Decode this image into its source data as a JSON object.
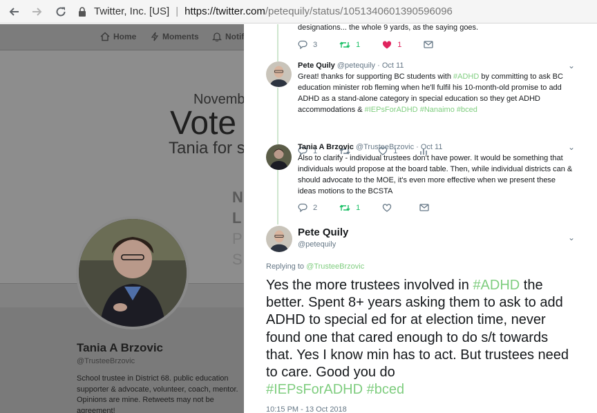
{
  "browser": {
    "back_icon": "arrow-left-icon",
    "forward_icon": "arrow-right-icon",
    "reload_icon": "reload-icon",
    "site_org": "Twitter, Inc. [US]",
    "url_scheme_host": "https://twitter.com",
    "url_path": "/petequily/status/1051340601390596096"
  },
  "profile_page": {
    "nav": {
      "home": "Home",
      "moments": "Moments",
      "notifications": "Notifi"
    },
    "banner": {
      "line1": "Novemb",
      "line2": "Vote",
      "line3": "Tania for s"
    },
    "name": "Tania A Brzovic",
    "handle": "@TrusteeBrzovic",
    "bio": "School trustee in District 68. public education supporter & advocate, volunteer, coach, mentor. Opinions are mine. Retweets may not be agreement!"
  },
  "thread": {
    "tweet0": {
      "text_tail": "designations... the whole 9 yards, as the saying goes.",
      "reply_count": "3",
      "retweet_count": "1",
      "like_count": "1"
    },
    "tweet1": {
      "name": "Pete Quily",
      "handle": "@petequily",
      "date": "· Oct 11",
      "text_a": "Great! thanks for supporting BC students with ",
      "tag_a": "#ADHD",
      "text_b": " by committing to ask BC education minister rob fleming when he'll fulfil his 10-month-old promise to add ADHD as a stand-alone category in special education so they get ADHD accommodations & ",
      "tag_b": "#IEPsForADHD",
      "tag_c": "#Nanaimo",
      "tag_d": "#bced",
      "reply_count": "1",
      "retweet_count": "",
      "like_count": "1"
    },
    "tweet2": {
      "name": "Tania A Brzovic",
      "handle": "@TrusteeBrzovic",
      "date": "· Oct 11",
      "text": "Also to clarify - individual trustees don't have power. It would be something that individuals would propose at the board table. Then, while individual districts can & should advocate to the MOE, it's even more effective when we present these ideas motions to the BCSTA",
      "reply_count": "2",
      "retweet_count": "1",
      "like_count": ""
    },
    "main": {
      "name": "Pete Quily",
      "handle": "@petequily",
      "replying_label": "Replying to ",
      "replying_handle": "@TrusteeBrzovic",
      "text_a": "Yes the more trustees involved in ",
      "tag_a": "#ADHD",
      "text_b": " the better. Spent 8+ years asking them to ask to add ADHD to special ed for at election time, never found one that cared enough to do s/t towards that. Yes I know min has to act. But trustees need to care. Good you do ",
      "tag_b": "#IEPsForADHD",
      "tag_c": "#bced",
      "timestamp": "10:15 PM - 13 Oct 2018"
    }
  },
  "colors": {
    "link_green": "#7fcd7f",
    "retweet_green": "#17bf63",
    "like_red": "#e0245e",
    "overlay_dim": "#6f6f6f"
  }
}
